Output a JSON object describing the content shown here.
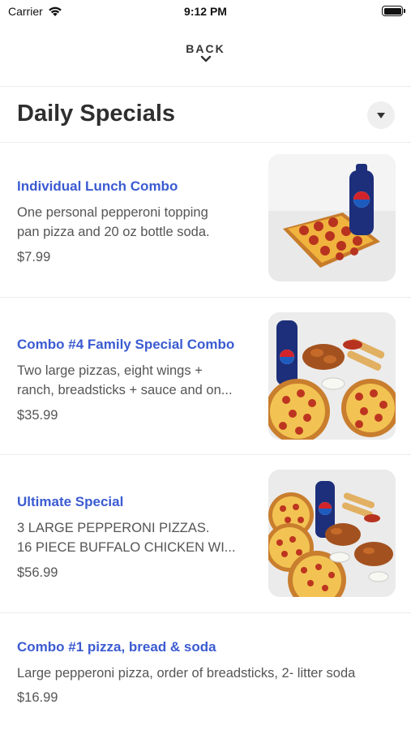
{
  "status_bar": {
    "carrier": "Carrier",
    "time": "9:12 PM"
  },
  "nav": {
    "back_label": "BACK"
  },
  "section": {
    "title": "Daily Specials"
  },
  "items": [
    {
      "name": "Individual Lunch Combo",
      "desc_line1": "One personal pepperoni topping",
      "desc_line2": "pan pizza and 20 oz bottle soda.",
      "price": "$7.99"
    },
    {
      "name": "Combo #4 Family Special Combo",
      "desc_line1": "Two large pizzas, eight wings +",
      "desc_line2": "ranch, breadsticks + sauce and on...",
      "price": "$35.99"
    },
    {
      "name": "Ultimate Special",
      "desc_line1": "3 LARGE PEPPERONI PIZZAS.",
      "desc_line2": "16 PIECE BUFFALO CHICKEN WI...",
      "price": "$56.99"
    },
    {
      "name": "Combo #1 pizza, bread & soda",
      "desc_line1": "Large pepperoni pizza, order of breadsticks, 2- litter soda",
      "price": "$16.99"
    }
  ],
  "colors": {
    "item_name": "#3b5bd1",
    "text": "#555555",
    "divider": "#ececec"
  }
}
